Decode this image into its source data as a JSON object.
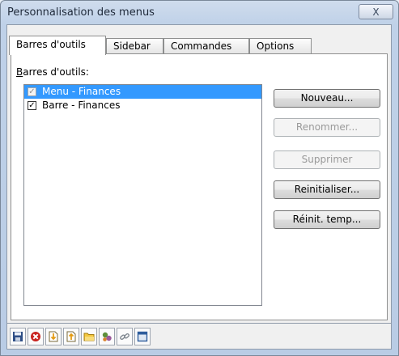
{
  "window": {
    "title": "Personnalisation des menus",
    "close_glyph": "X"
  },
  "tabs": [
    {
      "label": "Barres d'outils",
      "active": true
    },
    {
      "label": "Sidebar",
      "active": false
    },
    {
      "label": "Commandes",
      "active": false
    },
    {
      "label": "Options",
      "active": false
    }
  ],
  "panel": {
    "list_label_mnemonic": "B",
    "list_label_rest": "arres d'outils:",
    "items": [
      {
        "label": "Menu - Finances",
        "checked": true,
        "selected": true,
        "dimmed": true
      },
      {
        "label": "Barre - Finances",
        "checked": true,
        "selected": false,
        "dimmed": false
      }
    ],
    "buttons": [
      {
        "label": "Nouveau...",
        "enabled": true
      },
      {
        "label": "Renommer...",
        "enabled": false
      },
      {
        "label": "Supprimer",
        "enabled": false
      },
      {
        "label": "Reinitialiser...",
        "enabled": true
      },
      {
        "label": "Réinit. temp...",
        "enabled": true
      }
    ]
  },
  "toolbar": {
    "icons": [
      "save-icon",
      "cancel-icon",
      "import-icon",
      "export-icon",
      "open-folder-icon",
      "gears-icon",
      "link-icon",
      "window-icon"
    ]
  },
  "colors": {
    "selection": "#3399ff",
    "title_bar": "#cfdced"
  }
}
